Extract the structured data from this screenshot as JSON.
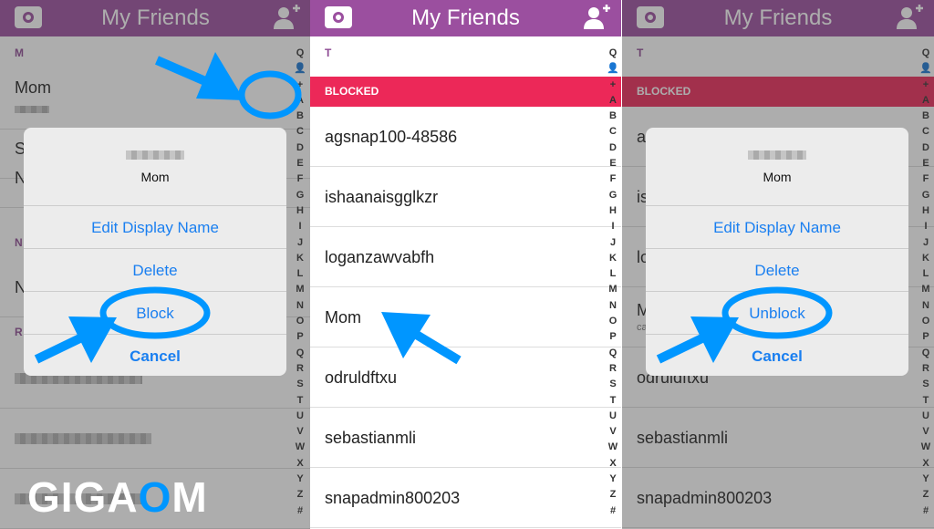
{
  "header": {
    "title": "My Friends"
  },
  "index": [
    "Q",
    "👤",
    "+",
    "A",
    "B",
    "C",
    "D",
    "E",
    "F",
    "G",
    "H",
    "I",
    "J",
    "K",
    "L",
    "M",
    "N",
    "O",
    "P",
    "Q",
    "R",
    "S",
    "T",
    "U",
    "V",
    "W",
    "X",
    "Y",
    "Z",
    "#"
  ],
  "left": {
    "sections": [
      "M",
      "N",
      "R"
    ],
    "mom": "Mom",
    "s_initial": "S",
    "n_initial": "N",
    "n2_initial": "N",
    "sheet": {
      "name": "Mom",
      "options": [
        "Edit Display Name",
        "Delete",
        "Block",
        "Cancel"
      ]
    }
  },
  "middle": {
    "section": "T",
    "blocked_label": "BLOCKED",
    "rows": [
      "agsnap100-48586",
      "ishaanaisgglkzr",
      "loganzawvabfh",
      "Mom",
      "odruldftxu",
      "sebastianmli",
      "snapadmin800203"
    ]
  },
  "right": {
    "section": "T",
    "blocked_label": "BLOCKED",
    "initials": [
      "a",
      "is",
      "lo",
      "M"
    ],
    "mom_sub": "ca",
    "sheet": {
      "name": "Mom",
      "options": [
        "Edit Display Name",
        "Delete",
        "Unblock",
        "Cancel"
      ]
    }
  },
  "watermark": {
    "text_a": "GIGA",
    "text_b": "O",
    "text_c": "M"
  },
  "colors": {
    "header": "#9b4f9f",
    "blocked": "#ec2858",
    "action": "#1a7ff0",
    "annotation": "#0096ff"
  }
}
